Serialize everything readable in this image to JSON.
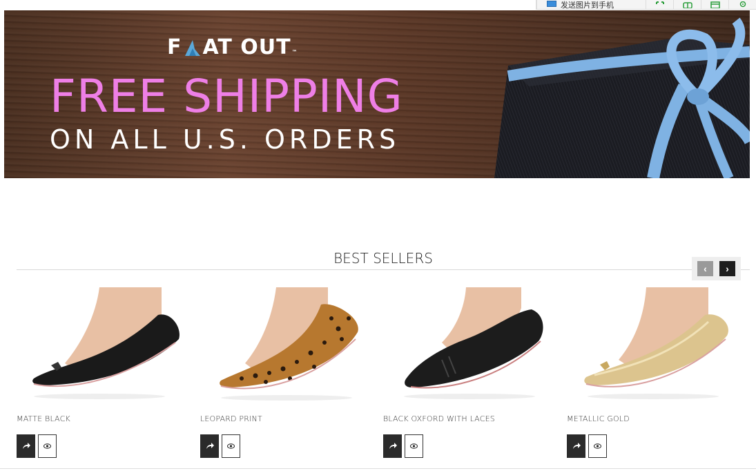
{
  "toolbar": {
    "text_item": "发送图片到手机",
    "icons": [
      "fullscreen-icon",
      "grid-icon",
      "window-icon",
      "settings-icon"
    ]
  },
  "banner": {
    "logo_left": "F",
    "logo_right": "AT OUT",
    "logo_tm": "™",
    "headline": "FREE SHIPPING",
    "subheadline": "ON ALL U.S. ORDERS",
    "headline_color": "#ee7fe6"
  },
  "best_sellers": {
    "title": "BEST SELLERS",
    "prev_label": "‹",
    "next_label": "›",
    "products": [
      {
        "name": "MATTE BLACK",
        "color": "#1a1a1a"
      },
      {
        "name": "LEOPARD PRINT",
        "color": "#b7782f"
      },
      {
        "name": "BLACK OXFORD WITH LACES",
        "color": "#1c1c1c"
      },
      {
        "name": "METALLIC GOLD",
        "color": "#dcc48e"
      }
    ]
  }
}
